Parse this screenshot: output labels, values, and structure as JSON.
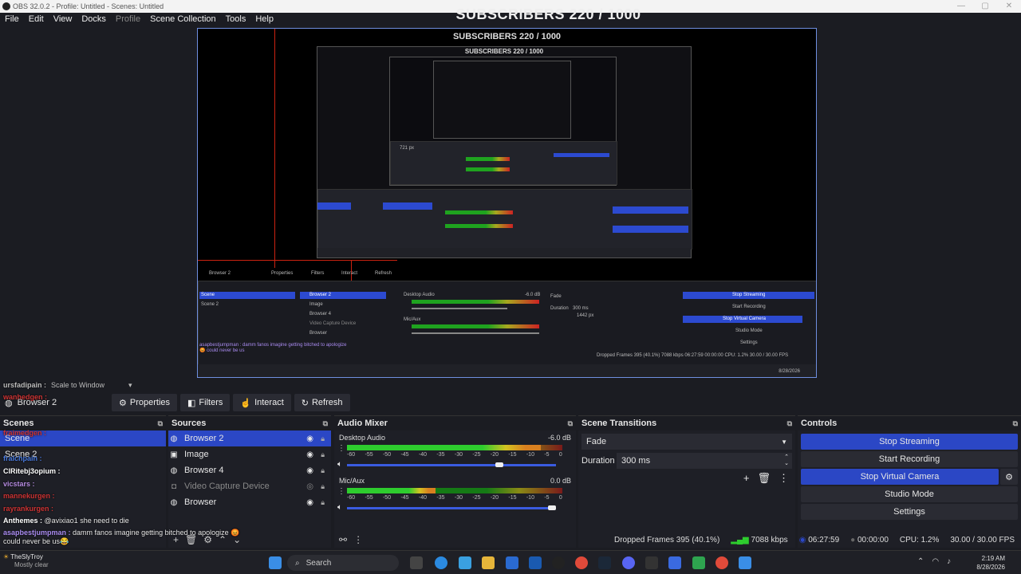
{
  "window": {
    "title": "OBS 32.0.2 - Profile: Untitled - Scenes: Untitled",
    "controls": [
      "—",
      "▢",
      "✕"
    ]
  },
  "menu": [
    "File",
    "Edit",
    "View",
    "Docks",
    "Profile",
    "Scene Collection",
    "Tools",
    "Help"
  ],
  "banner": "SUBSCRIBERS 220 / 1000",
  "preview": {
    "inner_banner": "SUBSCRIBERS 220 / 1000",
    "inner_buttons": {
      "properties": "Properties",
      "filters": "Filters",
      "interact": "Interact",
      "refresh": "Refresh"
    },
    "inner_sources": [
      "Browser 2",
      "Image",
      "Browser 4",
      "Video Capture Device",
      "Browser"
    ],
    "inner_scenes": [
      "Scene",
      "Scene 2"
    ],
    "inner_transition": "Fade",
    "inner_duration_label": "Duration",
    "inner_duration": "300 ms",
    "inner_res": "1442 px",
    "inner_controls": [
      "Stop Streaming",
      "Start Recording",
      "Stop Virtual Camera",
      "Studio Mode",
      "Settings"
    ],
    "inner_status": "Dropped Frames 395 (40.1%)   7088 kbps   06:27:59   00:00:00   CPU: 1.2%   30.00 / 30.00 FPS",
    "inner_px": "721 px",
    "inner_chat": "asapbestjumpman : damm fanos imagine getting bitched to apologize 😡 could never be us",
    "inner_mix": [
      "Desktop Audio",
      "Mic/Aux"
    ],
    "inner_mix_db": "-6.0 dB",
    "inner_date": "8/28/2026"
  },
  "context_bar": {
    "scale": "Scale to Window"
  },
  "toolbar": {
    "source_name": "Browser 2",
    "properties": "Properties",
    "filters": "Filters",
    "interact": "Interact",
    "refresh": "Refresh"
  },
  "scenes": {
    "title": "Scenes",
    "items": [
      "Scene",
      "Scene 2"
    ],
    "selected": 0
  },
  "sources": {
    "title": "Sources",
    "items": [
      {
        "name": "Browser 2",
        "icon": "globe-icon",
        "selected": true
      },
      {
        "name": "Image",
        "icon": "image-icon",
        "selected": false
      },
      {
        "name": "Browser 4",
        "icon": "globe-icon",
        "selected": false
      },
      {
        "name": "Video Capture Device",
        "icon": "camera-icon",
        "selected": false
      },
      {
        "name": "Browser",
        "icon": "globe-icon",
        "selected": false
      }
    ]
  },
  "mixer": {
    "title": "Audio Mixer",
    "channels": [
      {
        "name": "Desktop Audio",
        "db": "-6.0 dB",
        "level": 0.9,
        "fader": 0.73
      },
      {
        "name": "Mic/Aux",
        "db": "0.0 dB",
        "level": 0.41,
        "fader": 0.98
      }
    ],
    "scale": [
      "-60",
      "-55",
      "-50",
      "-45",
      "-40",
      "-35",
      "-30",
      "-25",
      "-20",
      "-15",
      "-10",
      "-5",
      "0"
    ]
  },
  "transitions": {
    "title": "Scene Transitions",
    "selected": "Fade",
    "duration_label": "Duration",
    "duration": "300 ms"
  },
  "controls": {
    "title": "Controls",
    "stop_streaming": "Stop Streaming",
    "start_recording": "Start Recording",
    "stop_virtual_camera": "Stop Virtual Camera",
    "studio_mode": "Studio Mode",
    "settings": "Settings"
  },
  "status": {
    "dropped": "Dropped Frames 395 (40.1%)",
    "kbps": "7088 kbps",
    "stream_time": "06:27:59",
    "rec_time": "00:00:00",
    "cpu": "CPU: 1.2%",
    "fps": "30.00 / 30.00 FPS"
  },
  "chat": [
    {
      "user": "ursfadipain :",
      "msg": "",
      "color": "#bbb"
    },
    {
      "user": "wanhedgen :",
      "msg": "",
      "color": "#c33"
    },
    {
      "user": "fraimedgen :",
      "msg": "",
      "color": "#c33"
    },
    {
      "user": "fralchpain :",
      "msg": "",
      "color": "#4a7be0"
    },
    {
      "user": "ClRitebj3opium :",
      "msg": "",
      "color": "#fff"
    },
    {
      "user": "vicstars :",
      "msg": "",
      "color": "#b58be0"
    },
    {
      "user": "mannekurgen :",
      "msg": "",
      "color": "#c33"
    },
    {
      "user": "rayrankurgen :",
      "msg": "",
      "color": "#c33"
    },
    {
      "user": "Anthemes :",
      "msg": "@avixiao1  she need to die",
      "color": "#fff"
    },
    {
      "user": "asapbestjumpman :",
      "msg": "damm fanos imagine getting bitched to apologize 😡 could never be us😂",
      "color": "#a98bf0"
    }
  ],
  "taskbar": {
    "search": "Search",
    "time": "2:19 AM",
    "date": "8/28/2026",
    "weather_temp": "TheSlyTroy",
    "weather_cond": "Mostly clear"
  },
  "colors": {
    "accent": "#2b47c5",
    "bg": "#1b1c22",
    "dock": "#1e1f26"
  }
}
